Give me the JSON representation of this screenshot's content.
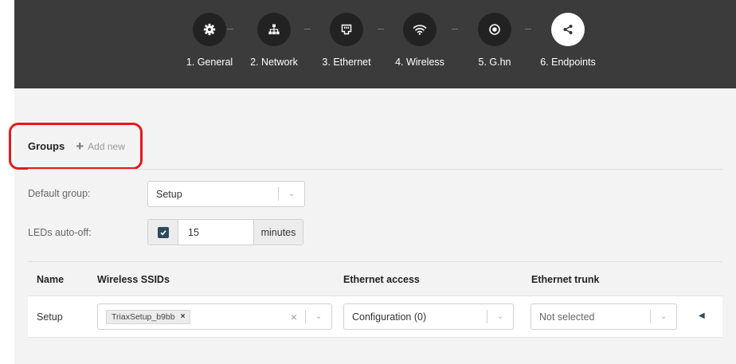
{
  "wizard": {
    "steps": [
      {
        "label": "1. General",
        "icon": "gear-icon"
      },
      {
        "label": "2. Network",
        "icon": "network-icon"
      },
      {
        "label": "3. Ethernet",
        "icon": "ethernet-port-icon"
      },
      {
        "label": "4. Wireless",
        "icon": "wifi-icon"
      },
      {
        "label": "5. G.hn",
        "icon": "target-icon"
      },
      {
        "label": "6. Endpoints",
        "icon": "share-icon"
      }
    ],
    "active_step": 6
  },
  "groups": {
    "title": "Groups",
    "add_new_label": "Add new"
  },
  "settings": {
    "default_group_label": "Default group:",
    "default_group_value": "Setup",
    "leds_label": "LEDs auto-off:",
    "leds_enabled": true,
    "leds_value": "15",
    "leds_unit": "minutes"
  },
  "table": {
    "columns": [
      "Name",
      "Wireless SSIDs",
      "Ethernet access",
      "Ethernet trunk"
    ],
    "rows": [
      {
        "name": "Setup",
        "ssid_tag": "TriaxSetup_b9bb",
        "ethernet_access": "Configuration (0)",
        "ethernet_trunk": "Not selected"
      }
    ]
  },
  "colors": {
    "header_bg": "#3b3b3b",
    "content_bg": "#f3f3f3",
    "highlight_border": "#e5191b",
    "checkbox": "#2d4a5c"
  }
}
